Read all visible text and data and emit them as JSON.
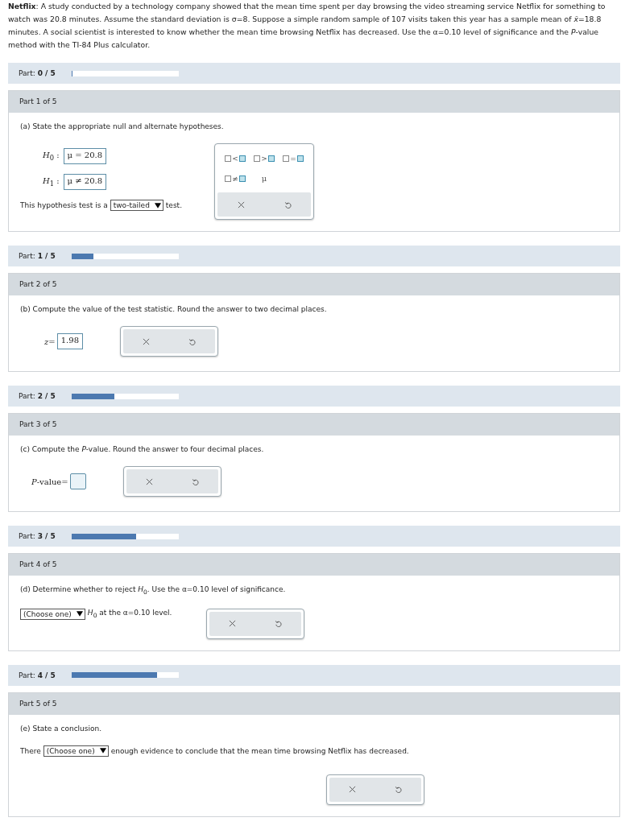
{
  "intro": "**Netflix**: A study conducted by a technology company showed that the mean time spent per day browsing the video streaming service Netflix for something to watch was 20.8 minutes. Assume the standard deviation is σ=8. Suppose a simple random sample of 107 visits taken this year has a sample mean of *x̄*=18.8 minutes. A social scientist is interested to know whether the mean time browsing Netflix has decreased. Use the α=0.10 level of significance and the *P*-value method with the TI-84 Plus calculator.",
  "parts": [
    {
      "progress": {
        "label": "Part:",
        "value": "0 / 5",
        "level": 0
      },
      "header": "Part 1 of 5",
      "question": "(a) State the appropriate null and alternate hypotheses.",
      "kind": "hypotheses",
      "hypotheses": [
        {
          "label": "*H*$_{0}$ :",
          "value": "μ = 20.8"
        },
        {
          "label": "*H*$_{1}$ :",
          "value": "μ ≠ 20.8"
        }
      ],
      "sentence": {
        "before": "This hypothesis test is a",
        "select": "two-tailed",
        "after": "test."
      },
      "palette": [
        {
          "kind": "template",
          "op": "<"
        },
        {
          "kind": "template",
          "op": ">"
        },
        {
          "kind": "template",
          "op": "="
        },
        {
          "kind": "template",
          "op": "≠"
        },
        {
          "kind": "symbol",
          "text": "μ"
        }
      ]
    },
    {
      "progress": {
        "label": "Part:",
        "value": "1 / 5",
        "level": 0.2
      },
      "header": "Part 2 of 5",
      "question": "(b) Compute the value of the test statistic. Round the answer to two decimal places.",
      "kind": "answer",
      "answer": {
        "label": "*z*=",
        "value": "1.98"
      }
    },
    {
      "progress": {
        "label": "Part:",
        "value": "2 / 5",
        "level": 0.4
      },
      "header": "Part 3 of 5",
      "question": "(c) Compute the *P*-value. Round the answer to four decimal places.",
      "kind": "answer",
      "answer": {
        "label": "*P*-value="
      }
    },
    {
      "progress": {
        "label": "Part:",
        "value": "3 / 5",
        "level": 0.6
      },
      "header": "Part 4 of 5",
      "question": "(d) Determine whether to reject *H*$_{0}$. Use the α=0.10 level of significance.",
      "kind": "select",
      "sentence": {
        "select": "(Choose one)",
        "after": "*H*$_{0}$ at the α=0.10 level."
      }
    },
    {
      "progress": {
        "label": "Part:",
        "value": "4 / 5",
        "level": 0.8
      },
      "header": "Part 5 of 5",
      "question": "(e) State a conclusion.",
      "kind": "conclusion",
      "sentence": {
        "before": "There",
        "select": "(Choose one)",
        "after": "enough evidence to conclude that the mean time browsing Netflix has decreased."
      }
    }
  ]
}
